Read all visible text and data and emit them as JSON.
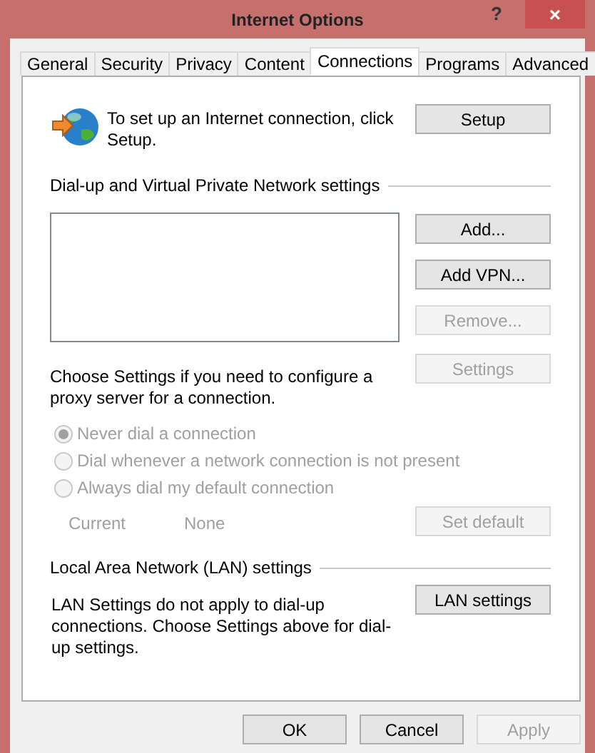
{
  "window": {
    "title": "Internet Options",
    "help": "?",
    "close": "×"
  },
  "tabs": [
    {
      "label": "General",
      "selected": false
    },
    {
      "label": "Security",
      "selected": false
    },
    {
      "label": "Privacy",
      "selected": false
    },
    {
      "label": "Content",
      "selected": false
    },
    {
      "label": "Connections",
      "selected": true
    },
    {
      "label": "Programs",
      "selected": false
    },
    {
      "label": "Advanced",
      "selected": false
    }
  ],
  "setup": {
    "text": "To set up an Internet connection, click Setup.",
    "button": {
      "label": "Setup",
      "disabled": false
    }
  },
  "dialup": {
    "heading": "Dial-up and Virtual Private Network settings",
    "buttons": [
      {
        "label": "Add...",
        "disabled": false
      },
      {
        "label": "Add VPN...",
        "disabled": false
      },
      {
        "label": "Remove...",
        "disabled": true
      }
    ]
  },
  "proxy": {
    "text": "Choose Settings if you need to configure a proxy server for a connection.",
    "button": {
      "label": "Settings",
      "disabled": true
    }
  },
  "dial_options": [
    {
      "label": "Never dial a connection",
      "selected": true,
      "disabled": true
    },
    {
      "label": "Dial whenever a network connection is not present",
      "selected": false,
      "disabled": true
    },
    {
      "label": "Always dial my default connection",
      "selected": false,
      "disabled": true
    }
  ],
  "current": {
    "label": "Current",
    "value": "None",
    "button": {
      "label": "Set default",
      "disabled": true
    }
  },
  "lan": {
    "heading": "Local Area Network (LAN) settings",
    "text": "LAN Settings do not apply to dial-up connections. Choose Settings above for dial-up settings.",
    "button": {
      "label": "LAN settings",
      "disabled": false
    }
  },
  "footer_buttons": [
    {
      "label": "OK",
      "disabled": false
    },
    {
      "label": "Cancel",
      "disabled": false
    },
    {
      "label": "Apply",
      "disabled": true
    }
  ]
}
